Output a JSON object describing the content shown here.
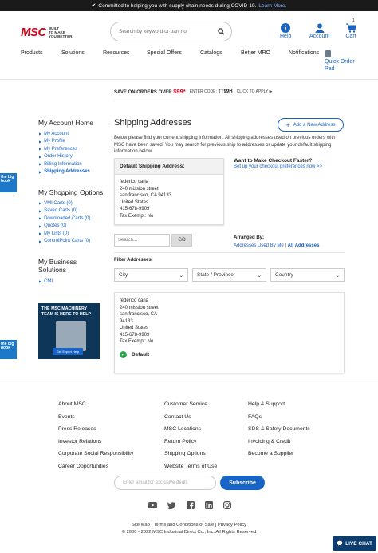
{
  "banner": {
    "text": "Committed to helping you with supply chain needs during COVID-19.",
    "link": "Learn More."
  },
  "header": {
    "logo": "MSC",
    "tagline": [
      "BUILT",
      "TO MAKE",
      "YOU BETTER"
    ],
    "search_placeholder": "Search by keyword or part nu",
    "help": "Help",
    "account": "Account",
    "cart": "Cart",
    "cart_count": "1"
  },
  "nav": {
    "items": [
      "Products",
      "Solutions",
      "Resources",
      "Special Offers",
      "Catalogs",
      "Better MRO",
      "Notifications"
    ],
    "quick_order": "Quick Order Pad"
  },
  "promo": {
    "save": "SAVE ON ORDERS OVER",
    "amount": "$99*",
    "code_label": "ENTER CODE:",
    "code": "TT99H",
    "apply": "CLICK TO APPLY"
  },
  "sidebar": {
    "account_title": "My Account Home",
    "account_items": [
      "My Account",
      "My Profile",
      "My Preferences",
      "Order History",
      "Billing Information",
      "Shipping Addresses"
    ],
    "shopping_title": "My Shopping Options",
    "shopping_items": [
      "VMI Carts (0)",
      "Saved Carts (0)",
      "Downloaded Carts (0)",
      "Quotes (0)",
      "My Lists (0)",
      "ControlPoint Carts (0)"
    ],
    "business_title": "My Business Solutions",
    "business_items": [
      "CMI"
    ],
    "ad_title": "THE MSC MACHINERY TEAM IS HERE TO HELP",
    "ad_button": "Get Expert Help",
    "bigbook": "the big book"
  },
  "main": {
    "title": "Shipping Addresses",
    "add_button": "Add a New Address",
    "description": "Below please find your current shipping information. All shipping addresses used on previous orders with MSC have been saved. You may search for previous ship to addresses or update your default shipping information below.",
    "default_header": "Default Shipping Address:",
    "default_address": [
      "federico caria",
      "240 mission street",
      "san francisco, CA 94133",
      "United States",
      "415-678-9909",
      "Tax Exempt: No"
    ],
    "checkout_title": "Want to Make Checkout Faster?",
    "checkout_link": "Set up your checkout preferences now >>",
    "search_placeholder": "Search...",
    "go": "GO",
    "arranged_by": "Arranged By:",
    "arranged_options": [
      "Addresses Used By Me",
      "All Addresses"
    ],
    "filter_label": "Filter Addresses:",
    "filters": [
      "City",
      "State / Province",
      "Country"
    ],
    "address_card": [
      "federico caria",
      "240 mission street",
      "san francisco, CA",
      "94133",
      "United States",
      "415-678-9909",
      "Tax Exempt: No"
    ],
    "default_badge": "Default"
  },
  "footer": {
    "col1": [
      "About MSC",
      "Events",
      "Press Releases",
      "Investor Relations",
      "Corporate Social Responsibility",
      "Career Opportunities"
    ],
    "col2": [
      "Customer Service",
      "Contact Us",
      "MSC Locations",
      "Return Policy",
      "Shipping Options",
      "Website Terms of Use"
    ],
    "col3": [
      "Help & Support",
      "FAQs",
      "SDS & Safety Documents",
      "Invoicing & Credit",
      "Become a Supplier"
    ],
    "email_placeholder": "Enter email for exclusive deals",
    "subscribe": "Subscribe",
    "social": [
      "youtube-icon",
      "twitter-icon",
      "facebook-icon",
      "linkedin-icon",
      "instagram-icon"
    ],
    "links": "Site Map | Terms and Conditions of Sale | Privacy Policy",
    "copyright": "© 2000 - 2022 MSC Industrial Direct Co., Inc. All Rights Reserved",
    "chat": "LIVE CHAT"
  }
}
